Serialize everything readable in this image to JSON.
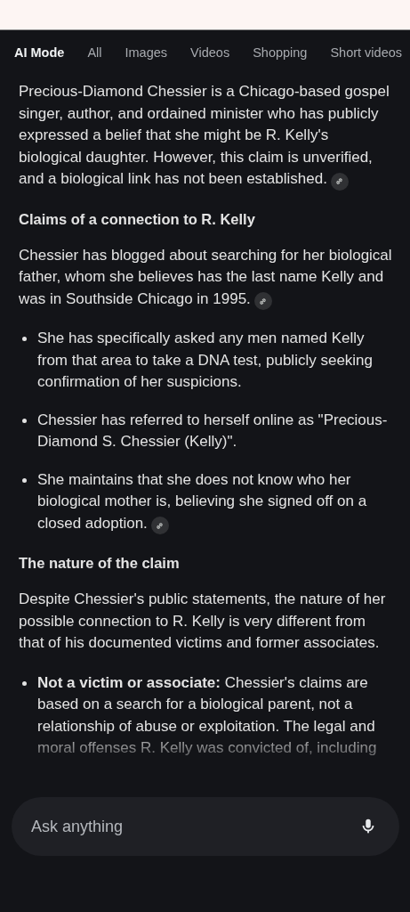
{
  "tabs": [
    {
      "label": "AI Mode",
      "selected": true
    },
    {
      "label": "All",
      "selected": false
    },
    {
      "label": "Images",
      "selected": false
    },
    {
      "label": "Videos",
      "selected": false
    },
    {
      "label": "Shopping",
      "selected": false
    },
    {
      "label": "Short videos",
      "selected": false
    }
  ],
  "blocks": [
    {
      "kind": "paragraph",
      "text": "Precious-Diamond Chessier is a Chicago-based gospel singer, author, and ordained minister who has publicly expressed a belief that she might be R. Kelly's biological daughter. However, this claim is unverified, and a biological link has not been established.",
      "link": true
    },
    {
      "kind": "heading",
      "text": "Claims of a connection to R. Kelly"
    },
    {
      "kind": "paragraph",
      "text": "Chessier has blogged about searching for her biological father, whom she believes has the last name Kelly and was in Southside Chicago in 1995.",
      "link": true
    },
    {
      "kind": "bullets",
      "items": [
        {
          "text": "She has specifically asked any men named Kelly from that area to take a DNA test, publicly seeking confirmation of her suspicions."
        },
        {
          "text": "Chessier has referred to herself online as \"Precious-Diamond S. Chessier (Kelly)\"."
        },
        {
          "text": "She maintains that she does not know who her biological mother is, believing she signed off on a closed adoption.",
          "link": true
        }
      ]
    },
    {
      "kind": "heading",
      "text": "The nature of the claim"
    },
    {
      "kind": "paragraph",
      "text": "Despite Chessier's public statements, the nature of her possible connection to R. Kelly is very different from that of his documented victims and former associates."
    },
    {
      "kind": "bullets",
      "items": [
        {
          "text": "**Not a victim or associate:** Chessier's claims are based on a search for a biological parent, not a relationship of abuse or exploitation. The legal and moral offenses R. Kelly was convicted of, including"
        }
      ]
    }
  ],
  "input": {
    "placeholder": "Ask anything"
  }
}
